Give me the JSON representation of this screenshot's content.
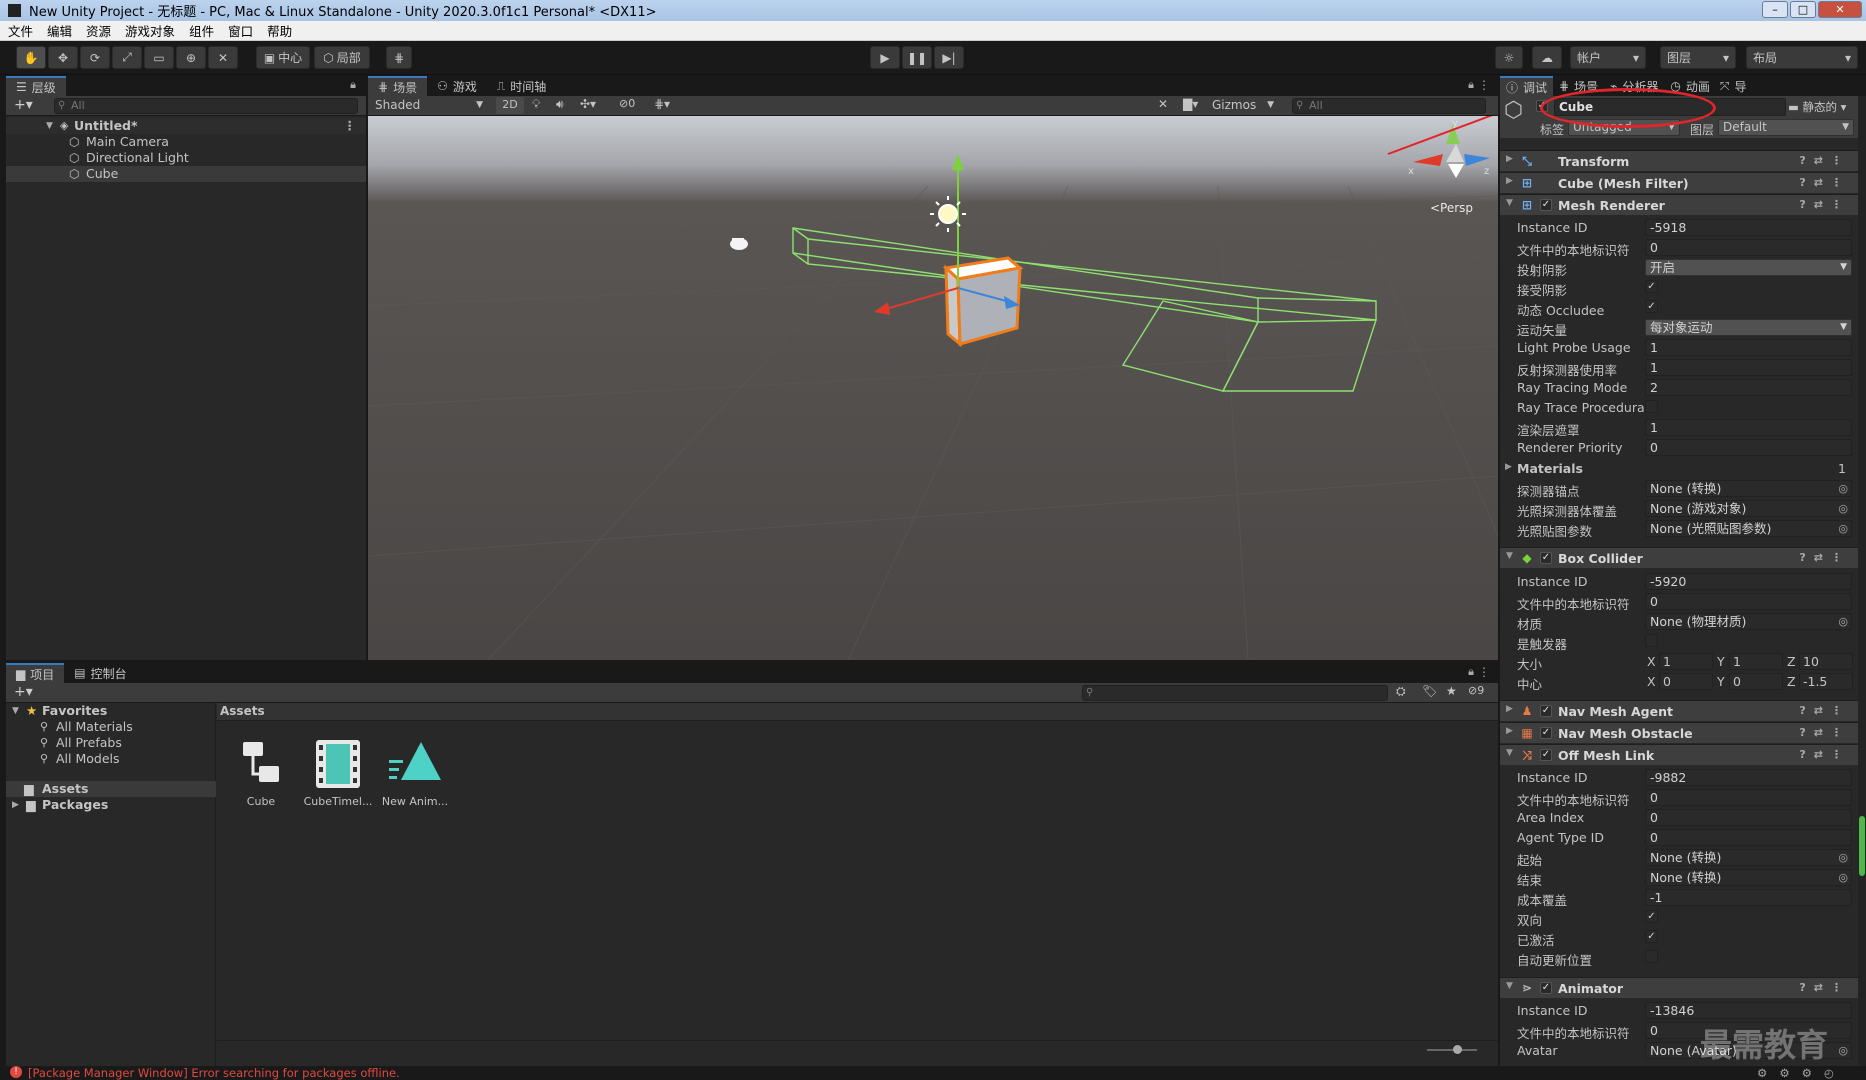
{
  "window": {
    "title": "New Unity Project - 无标题 - PC, Mac & Linux Standalone - Unity 2020.3.0f1c1 Personal* <DX11>",
    "controls": [
      "–",
      "□",
      "✕"
    ]
  },
  "menu": [
    "文件",
    "编辑",
    "资源",
    "游戏对象",
    "组件",
    "窗口",
    "帮助"
  ],
  "toolbar": {
    "pivot_label": "中心",
    "space_label": "局部",
    "account_label": "帐户",
    "layers_label": "图层",
    "layout_label": "布局"
  },
  "hierarchy": {
    "tab_label": "层级",
    "search_placeholder": "All",
    "scene_name": "Untitled*",
    "objects": [
      "Main Camera",
      "Directional Light",
      "Cube"
    ]
  },
  "scene": {
    "tabs": [
      "场景",
      "游戏",
      "时间轴"
    ],
    "shading_mode": "Shaded",
    "mode_2d": "2D",
    "hidden_count": "0",
    "gizmos_label": "Gizmos",
    "search_placeholder": "All",
    "persp_label": "<Persp"
  },
  "project": {
    "tabs": [
      "项目",
      "控制台"
    ],
    "favorites_label": "Favorites",
    "favorites": [
      "All Materials",
      "All Prefabs",
      "All Models"
    ],
    "roots": [
      "Assets",
      "Packages"
    ],
    "breadcrumb": "Assets",
    "assets": [
      {
        "name": "Cube",
        "icon": "prefab-icon"
      },
      {
        "name": "CubeTimel...",
        "icon": "timeline-icon"
      },
      {
        "name": "New Anim...",
        "icon": "animation-icon"
      }
    ],
    "hidden_packages_count": "9"
  },
  "status": {
    "message": "[Package Manager Window] Error searching for packages offline."
  },
  "inspector": {
    "tabs": [
      "调试",
      "场景",
      "分析器",
      "动画",
      "导"
    ],
    "object_name": "Cube",
    "static_label": "静态的",
    "tag_label": "标签",
    "tag_value": "Untagged",
    "layer_label": "图层",
    "layer_value": "Default",
    "components": {
      "transform": "Transform",
      "mesh_filter": "Cube (Mesh Filter)",
      "mesh_renderer": {
        "title": "Mesh Renderer",
        "rows": [
          {
            "label": "Instance ID",
            "value": "-5918",
            "kind": "field"
          },
          {
            "label": "文件中的本地标识符",
            "value": "0",
            "kind": "field"
          },
          {
            "label": "投射阴影",
            "value": "开启",
            "kind": "drop"
          },
          {
            "label": "接受阴影",
            "value": "✓",
            "kind": "check"
          },
          {
            "label": "动态 Occludee",
            "value": "✓",
            "kind": "check"
          },
          {
            "label": "运动矢量",
            "value": "每对象运动",
            "kind": "drop"
          },
          {
            "label": "Light Probe Usage",
            "value": "1",
            "kind": "field"
          },
          {
            "label": "反射探测器使用率",
            "value": "1",
            "kind": "field"
          },
          {
            "label": "Ray Tracing Mode",
            "value": "2",
            "kind": "field"
          },
          {
            "label": "Ray Trace Procedural",
            "value": "",
            "kind": "check"
          },
          {
            "label": "渲染层遮罩",
            "value": "1",
            "kind": "field"
          },
          {
            "label": "Renderer Priority",
            "value": "0",
            "kind": "field"
          }
        ],
        "materials_label": "Materials",
        "materials_count": "1",
        "ref_rows": [
          {
            "label": "探测器锚点",
            "value": "None (转换)"
          },
          {
            "label": "光照探测器体覆盖",
            "value": "None (游戏对象)"
          },
          {
            "label": "光照贴图参数",
            "value": "None (光照贴图参数)"
          }
        ]
      },
      "box_collider": {
        "title": "Box Collider",
        "rows": [
          {
            "label": "Instance ID",
            "value": "-5920",
            "kind": "field"
          },
          {
            "label": "文件中的本地标识符",
            "value": "0",
            "kind": "field"
          },
          {
            "label": "材质",
            "value": "None (物理材质)",
            "kind": "ref"
          },
          {
            "label": "是触发器",
            "value": "",
            "kind": "check"
          }
        ],
        "size_label": "大小",
        "size": {
          "x": "1",
          "y": "1",
          "z": "10"
        },
        "center_label": "中心",
        "center": {
          "x": "0",
          "y": "0",
          "z": "-1.5"
        }
      },
      "nav_mesh_agent": "Nav Mesh Agent",
      "nav_mesh_obstacle": "Nav Mesh Obstacle",
      "off_mesh_link": {
        "title": "Off Mesh Link",
        "rows": [
          {
            "label": "Instance ID",
            "value": "-9882",
            "kind": "field"
          },
          {
            "label": "文件中的本地标识符",
            "value": "0",
            "kind": "field"
          },
          {
            "label": "Area Index",
            "value": "0",
            "kind": "field"
          },
          {
            "label": "Agent Type ID",
            "value": "0",
            "kind": "field"
          },
          {
            "label": "起始",
            "value": "None (转换)",
            "kind": "ref"
          },
          {
            "label": "结束",
            "value": "None (转换)",
            "kind": "ref"
          },
          {
            "label": "成本覆盖",
            "value": "-1",
            "kind": "field"
          },
          {
            "label": "双向",
            "value": "✓",
            "kind": "check"
          },
          {
            "label": "已激活",
            "value": "✓",
            "kind": "check"
          },
          {
            "label": "自动更新位置",
            "value": "",
            "kind": "check"
          }
        ]
      },
      "animator": {
        "title": "Animator",
        "rows": [
          {
            "label": "Instance ID",
            "value": "-13846",
            "kind": "field"
          },
          {
            "label": "文件中的本地标识符",
            "value": "0",
            "kind": "field"
          },
          {
            "label": "Avatar",
            "value": "None (Avatar)",
            "kind": "ref"
          }
        ]
      }
    }
  },
  "watermark": "最需教育",
  "colors": {
    "accent": "#3a79bb",
    "highlight_circle": "#e0252b",
    "selection_outline": "#f07c1a",
    "collider_green": "#8fe070"
  }
}
